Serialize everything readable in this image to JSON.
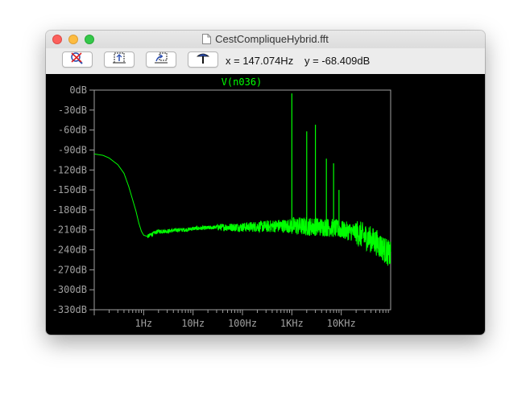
{
  "window": {
    "title": "CestCompliqueHybrid.fft"
  },
  "toolbar": {
    "buttons": [
      {
        "icon": "zoom-cancel-icon"
      },
      {
        "icon": "zoom-full-icon"
      },
      {
        "icon": "zoom-back-icon"
      },
      {
        "icon": "pan-icon"
      }
    ],
    "cursor_x": "x = 147.074Hz",
    "cursor_y": "y = -68.409dB"
  },
  "chart_data": {
    "type": "line",
    "title": "V(n036)",
    "x_scale": "log",
    "xlim": [
      0.1,
      100000
    ],
    "ylim": [
      -330,
      0
    ],
    "y_ticks": [
      "0dB",
      "-30dB",
      "-60dB",
      "-90dB",
      "-120dB",
      "-150dB",
      "-180dB",
      "-210dB",
      "-240dB",
      "-270dB",
      "-300dB",
      "-330dB"
    ],
    "y_tick_values": [
      0,
      -30,
      -60,
      -90,
      -120,
      -150,
      -180,
      -210,
      -240,
      -270,
      -300,
      -330
    ],
    "x_ticks": [
      "1Hz",
      "10Hz",
      "100Hz",
      "1KHz",
      "10KHz"
    ],
    "x_tick_values": [
      1,
      10,
      100,
      1000,
      10000
    ],
    "grid": false,
    "colors": {
      "trace": "#00ff00",
      "axis": "#a0a0a0",
      "tick_label": "#a0a0a0",
      "background": "#000000"
    },
    "series": [
      {
        "name": "V(n036)",
        "x": [
          0.1,
          0.15,
          0.2,
          0.3,
          0.4,
          0.5,
          0.6,
          0.7,
          0.8,
          0.9,
          1.0,
          1.2,
          1.5,
          2,
          3,
          5,
          7,
          10,
          20,
          30,
          50,
          100,
          200,
          300,
          500,
          800,
          1000,
          2000,
          3000,
          5000,
          8000,
          10000,
          20000,
          30000,
          50000,
          100000
        ],
        "y": [
          -96,
          -98,
          -102,
          -112,
          -125,
          -145,
          -165,
          -182,
          -200,
          -212,
          -218,
          -220,
          -216,
          -212,
          -212,
          -210,
          -210,
          -208,
          -207,
          -206,
          -206,
          -206,
          -205,
          -205,
          -204,
          -204,
          -204,
          -205,
          -205,
          -206,
          -208,
          -210,
          -214,
          -220,
          -228,
          -248
        ],
        "spikes": [
          {
            "x": 1000,
            "y": -5
          },
          {
            "x": 2000,
            "y": -62
          },
          {
            "x": 3000,
            "y": -52
          },
          {
            "x": 5000,
            "y": -103
          },
          {
            "x": 7000,
            "y": -110
          },
          {
            "x": 9000,
            "y": -150
          }
        ]
      }
    ]
  }
}
